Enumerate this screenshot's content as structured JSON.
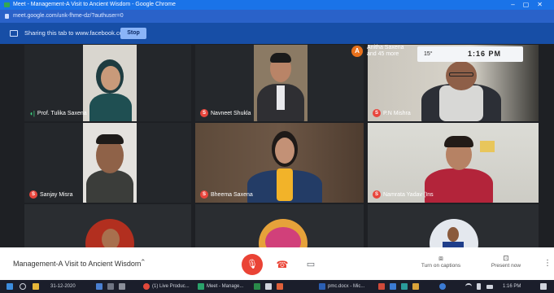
{
  "browser": {
    "window_title": "Meet - Management-A Visit to Ancient Wisdom - Google Chrome",
    "url": "meet.google.com/unk-fhme-dz/?authuser=0"
  },
  "share_banner": {
    "text": "Sharing this tab to www.facebook.com",
    "stop_label": "Stop"
  },
  "participants": [
    {
      "name": "Prof. Tulika Saxena",
      "initial": ""
    },
    {
      "name": "Navneet Shukla",
      "initial": "S"
    },
    {
      "name": "P.N Mishra",
      "initial": "S"
    },
    {
      "name": "Sanjay Misra",
      "initial": "S"
    },
    {
      "name": "Bheema Saxena",
      "initial": "S"
    },
    {
      "name": "Namrata Yadav (Ins",
      "initial": "S"
    }
  ],
  "extra": {
    "initial": "A",
    "line1": "Anitha Saxena",
    "line2": "and 45 more"
  },
  "clock": {
    "signal": "15°",
    "time": "1:16 PM"
  },
  "meet_bar": {
    "meeting_title": "Management-A Visit to Ancient Wisdom",
    "captions_label": "Turn on captions",
    "present_label": "Present now"
  },
  "taskbar": {
    "date": "31-12-2020",
    "item1": "(1) Live Produc...",
    "item2": "Meet - Manage...",
    "item3": "pmc.docx - Mic...",
    "clock": "1:16 PM"
  }
}
